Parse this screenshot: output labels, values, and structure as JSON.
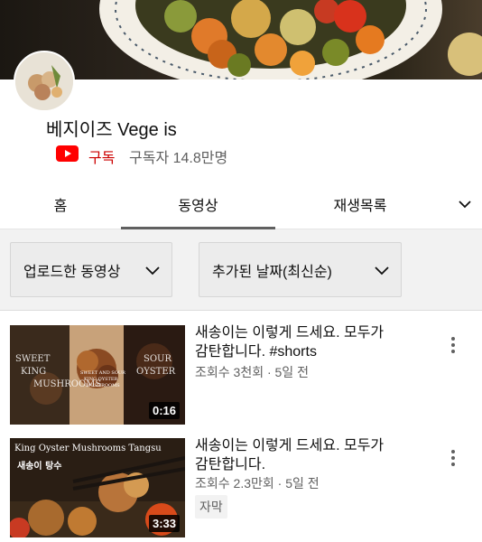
{
  "channel": {
    "name": "베지이즈 Vege is",
    "subscribe_label": "구독",
    "subscriber_count": "구독자 14.8만명"
  },
  "tabs": [
    {
      "label": "홈",
      "selected": false
    },
    {
      "label": "동영상",
      "selected": true
    },
    {
      "label": "재생목록",
      "selected": false
    }
  ],
  "filters": {
    "type_selected": "업로드한 동영상",
    "sort_selected": "추가된 날짜(최신순)"
  },
  "videos": [
    {
      "title_line1": "새송이는 이렇게 드세요. 모두가",
      "title_line2": "감탄합니다. #shorts",
      "meta": "조회수 3천회 · 5일 전",
      "duration": "0:16",
      "thumb_text": [
        "SWEET",
        "SOUR",
        "KING",
        "OYSTER",
        "MUSHROOMS",
        "SWEET AND SOUR",
        "KING OYSTER",
        "MUSHROOMS"
      ]
    },
    {
      "title_line1": "새송이는 이렇게 드세요. 모두가",
      "title_line2": "감탄합니다.",
      "meta": "조회수 2.3만회 · 5일 전",
      "duration": "3:33",
      "badge": "자막",
      "thumb_text": [
        "King Oyster Mushrooms Tangsu",
        "새송이 탕수"
      ]
    }
  ],
  "colors": {
    "accent_red": "#cc0000",
    "text_primary": "#0f0f0f",
    "text_secondary": "#606060"
  }
}
